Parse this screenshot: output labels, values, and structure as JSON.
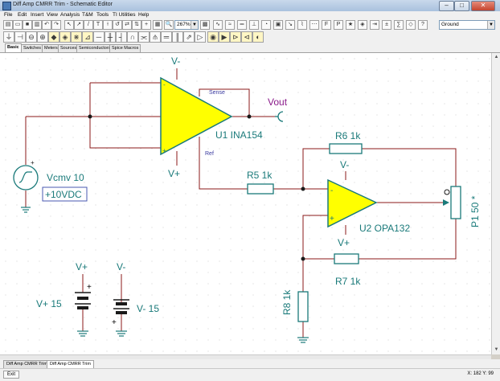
{
  "window": {
    "title": "Diff Amp CMRR Trim - Schematic Editor",
    "close": "✕"
  },
  "menu": [
    "File",
    "Edit",
    "Insert",
    "View",
    "Analysis",
    "T&M",
    "Tools",
    "TI Utilities",
    "Help"
  ],
  "toolbar": {
    "zoom": "267%",
    "ground_select": "Ground"
  },
  "component_tabs": [
    "Basic",
    "Switches",
    "Meters",
    "Sources",
    "Semiconductors",
    "Spice Macros"
  ],
  "components": {
    "u1": {
      "name": "U1 INA154",
      "pin_sense": "Sense",
      "pin_ref": "Ref",
      "supply_top": "V-",
      "supply_bottom": "V+"
    },
    "u2": {
      "name": "U2 OPA132",
      "supply_top": "V-",
      "supply_bottom": "V+"
    },
    "vout": "Vout",
    "vcmv": {
      "name": "Vcmv 10",
      "value": "+10VDC"
    },
    "r5": "R5 1k",
    "r6": "R6 1k",
    "r7": "R7 1k",
    "r8": "R8 1k",
    "p1": "P1 50 *",
    "vplus": {
      "label": "V+",
      "value": "V+ 15"
    },
    "vminus": {
      "label": "V-",
      "value": "V- 15"
    },
    "plus_sign": "+",
    "minus_sign": "-"
  },
  "doc_tabs": [
    "Diff Amp CMRR Trim 3",
    "Diff Amp CMRR Trim"
  ],
  "status": {
    "exit": "Exit",
    "coords": "X: 182  Y: 99"
  },
  "colors": {
    "wire": "#8b1a1a",
    "opamp_fill": "#ffff00",
    "label": "#1a7a7a",
    "vout": "#8a1a8a"
  }
}
